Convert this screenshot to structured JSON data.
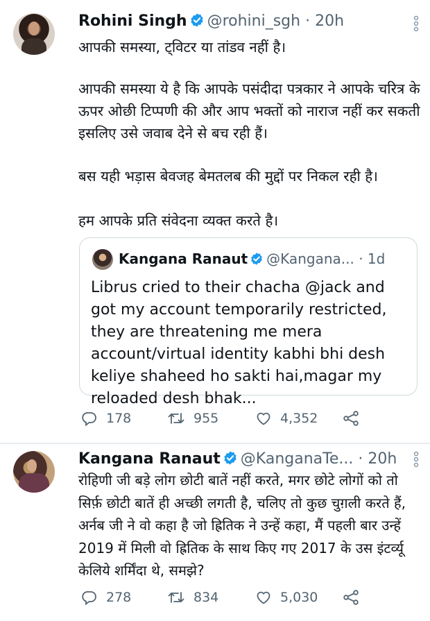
{
  "tweets": [
    {
      "author": {
        "name": "Rohini Singh",
        "handle": "@rohini_sgh",
        "time": "· 20h"
      },
      "paragraphs": [
        "आपकी समस्या, ट्विटर या तांडव नहीं है।",
        "आपकी समस्या ये है कि आपके पसंदीदा पत्रकार ने आपके चरित्र के ऊपर ओछी टिप्पणी की और आप भक्तों को नाराज नहीं कर सकती इसलिए उसे जवाब देने से बच रही हैं।",
        "बस यही भड़ास बेवजह बेमतलब की मुद्दों पर निकल रही है।",
        "हम आपके प्रति संवेदना व्यक्त करते है।"
      ],
      "quote": {
        "name": "Kangana Ranaut",
        "handle": "@Kangana...",
        "time": "· 1d",
        "text": "Librus cried to their chacha @jack and got my account temporarily restricted, they are threatening me mera account/virtual identity kabhi bhi desh keliye shaheed ho sakti hai,magar my reloaded desh bhak..."
      },
      "actions": {
        "replies": "178",
        "retweets": "955",
        "likes": "4,352"
      }
    },
    {
      "author": {
        "name": "Kangana Ranaut",
        "handle": "@KanganaTe...",
        "time": "· 20h"
      },
      "paragraphs": [
        "रोहिणी जी बड़े लोग छोटी बातें नहीं करते, मगर छोटे लोगों को तो सिर्फ़ छोटी बातें ही अच्छी लगती है, चलिए तो कुछ चुग़ली करते हैं, अर्नब जी ने वो कहा है जो ह्रितिक ने उन्हें कहा, मैं पहली बार उन्हें 2019 में मिली वो ह्रितिक के साथ किए गए 2017 के उस इंटर्व्यू केलिये शर्मिंदा थे, समझे?"
      ],
      "actions": {
        "replies": "278",
        "retweets": "834",
        "likes": "5,030"
      }
    }
  ],
  "icons": {
    "verified": "verified-badge-icon",
    "more": "more-vertical-icon",
    "reply": "reply-icon",
    "retweet": "retweet-icon",
    "like": "like-icon",
    "share": "share-icon"
  },
  "colors": {
    "verified": "#1d9bf0",
    "text": "#0f1419",
    "secondary": "#536471",
    "border": "#cfd9de"
  }
}
